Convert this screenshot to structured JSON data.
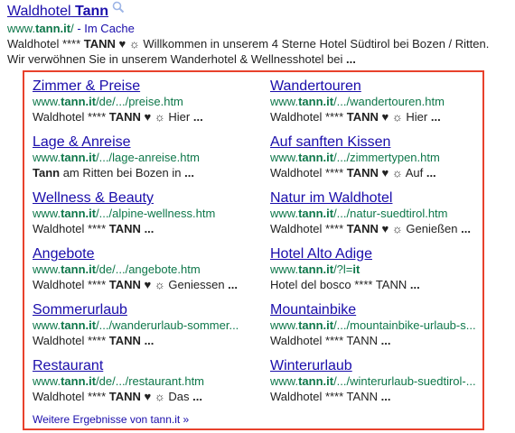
{
  "result": {
    "title_prefix": "Waldhotel",
    "title_bold": "Tann",
    "url_prefix": "www.",
    "url_bold": "tann.it",
    "url_suffix": "/",
    "cache_label": "- Im Cache",
    "snippet_line1_a": "Waldhotel **** ",
    "snippet_line1_bold": "TANN",
    "snippet_line1_b": " ♥ ☼ Willkommen in unserem 4 Sterne Hotel Südtirol bei Bozen / Ritten.",
    "snippet_line2": "Wir verwöhnen Sie in unserem Wanderhotel & Wellnesshotel bei",
    "snippet_line2_ellipsis": "..."
  },
  "sitelinks": {
    "left": [
      {
        "title": "Zimmer & Preise",
        "url_pre": "www.",
        "url_bold": "tann.it",
        "url_post": "/de/.../preise.htm",
        "snippet_pre": "Waldhotel **** ",
        "snippet_bold": "TANN",
        "snippet_post": " ♥ ☼ Hier ",
        "snippet_end": "..."
      },
      {
        "title": "Lage & Anreise",
        "url_pre": "www.",
        "url_bold": "tann.it",
        "url_post": "/.../lage-anreise.htm",
        "snippet_pre": "",
        "snippet_bold": "Tann",
        "snippet_post": " am Ritten bei Bozen in ",
        "snippet_end": "..."
      },
      {
        "title": "Wellness & Beauty",
        "url_pre": "www.",
        "url_bold": "tann.it",
        "url_post": "/.../alpine-wellness.htm",
        "snippet_pre": "Waldhotel **** ",
        "snippet_bold": "TANN",
        "snippet_post": " ",
        "snippet_end": "..."
      },
      {
        "title": "Angebote",
        "url_pre": "www.",
        "url_bold": "tann.it",
        "url_post": "/de/.../angebote.htm",
        "snippet_pre": "Waldhotel **** ",
        "snippet_bold": "TANN",
        "snippet_post": " ♥ ☼ Geniessen ",
        "snippet_end": "..."
      },
      {
        "title": "Sommerurlaub",
        "url_pre": "www.",
        "url_bold": "tann.it",
        "url_post": "/.../wanderurlaub-sommer...",
        "snippet_pre": "Waldhotel **** ",
        "snippet_bold": "TANN",
        "snippet_post": " ",
        "snippet_end": "..."
      },
      {
        "title": "Restaurant",
        "url_pre": "www.",
        "url_bold": "tann.it",
        "url_post": "/de/.../restaurant.htm",
        "snippet_pre": "Waldhotel **** ",
        "snippet_bold": "TANN",
        "snippet_post": " ♥ ☼ Das ",
        "snippet_end": "..."
      }
    ],
    "right": [
      {
        "title": "Wandertouren",
        "url_pre": "www.",
        "url_bold": "tann.it",
        "url_post": "/.../wandertouren.htm",
        "snippet_pre": "Waldhotel **** ",
        "snippet_bold": "TANN",
        "snippet_post": " ♥ ☼ Hier ",
        "snippet_end": "..."
      },
      {
        "title": "Auf sanften Kissen",
        "url_pre": "www.",
        "url_bold": "tann.it",
        "url_post": "/.../zimmertypen.htm",
        "snippet_pre": "Waldhotel **** ",
        "snippet_bold": "TANN",
        "snippet_post": " ♥ ☼ Auf ",
        "snippet_end": "..."
      },
      {
        "title": "Natur im Waldhotel",
        "url_pre": "www.",
        "url_bold": "tann.it",
        "url_post": "/.../natur-suedtirol.htm",
        "snippet_pre": "Waldhotel **** ",
        "snippet_bold": "TANN",
        "snippet_post": " ♥ ☼ Genießen ",
        "snippet_end": "..."
      },
      {
        "title": "Hotel Alto Adige",
        "url_pre": "www.",
        "url_bold": "tann.it",
        "url_post": "/?l=",
        "url_post_bold": "it",
        "snippet_pre": "Hotel del bosco **** TANN ",
        "snippet_bold": "",
        "snippet_post": "",
        "snippet_end": "..."
      },
      {
        "title": "Mountainbike",
        "url_pre": "www.",
        "url_bold": "tann.it",
        "url_post": "/.../mountainbike-urlaub-s...",
        "snippet_pre": "Waldhotel **** TANN ",
        "snippet_bold": "",
        "snippet_post": "",
        "snippet_end": "..."
      },
      {
        "title": "Winterurlaub",
        "url_pre": "www.",
        "url_bold": "tann.it",
        "url_post": "/.../winterurlaub-suedtirol-...",
        "snippet_pre": "Waldhotel **** TANN ",
        "snippet_bold": "",
        "snippet_post": "",
        "snippet_end": "..."
      }
    ]
  },
  "more_results_label": "Weitere Ergebnisse von tann.it »",
  "colors": {
    "link": "#1a0dab",
    "url_green": "#0e774a",
    "highlight_border": "#e8412c"
  },
  "icons": {
    "magnifier": "search-icon"
  }
}
